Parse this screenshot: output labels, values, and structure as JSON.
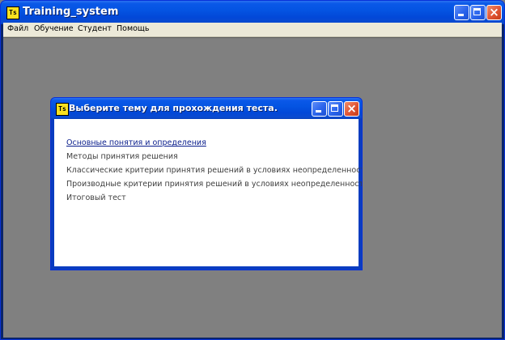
{
  "window": {
    "icon_text": "Ts",
    "title": "Training_system"
  },
  "menu": {
    "items": [
      {
        "label": "Файл"
      },
      {
        "label": "Обучение"
      },
      {
        "label": "Студент"
      },
      {
        "label": "Помощь"
      }
    ]
  },
  "dialog": {
    "icon_text": "Ts",
    "title": "Выберите тему для прохождения теста.",
    "topics": [
      {
        "label": "Основные понятия и определения",
        "state": "hovered-link"
      },
      {
        "label": "Методы принятия решения"
      },
      {
        "label": "Классические критерии принятия решений в условиях неопределенности"
      },
      {
        "label": "Производные критерии принятия решений в условиях неопределенности"
      },
      {
        "label": "Итоговый тест"
      }
    ]
  },
  "icons": {
    "app": "app-icon",
    "minimize": "minimize-icon",
    "maximize": "maximize-icon",
    "close": "close-icon"
  },
  "colors": {
    "title_bar": "#0454e2",
    "desktop": "#808080",
    "menu_bar": "#ece9d8",
    "link": "#0a1e8c",
    "close_button": "#e05434"
  }
}
